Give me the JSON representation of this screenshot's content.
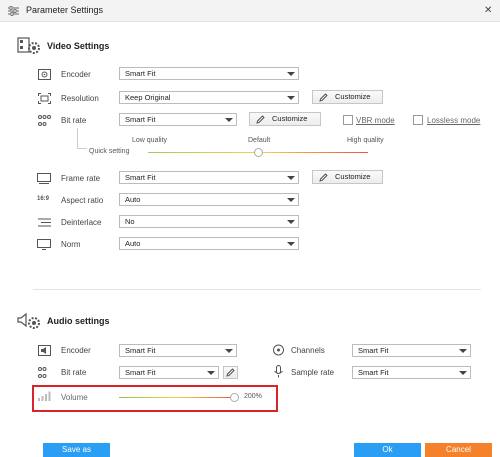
{
  "window": {
    "title": "Parameter Settings"
  },
  "video": {
    "section_title": "Video Settings",
    "encoder": {
      "label": "Encoder",
      "value": "Smart Fit"
    },
    "resolution": {
      "label": "Resolution",
      "value": "Keep Original",
      "customize": "Customize"
    },
    "bitrate": {
      "label": "Bit rate",
      "value": "Smart Fit",
      "customize": "Customize",
      "vbr_label": "VBR mode",
      "lossless_label": "Lossless mode",
      "quick_setting": "Quick setting",
      "low": "Low quality",
      "default": "Default",
      "high": "High quality",
      "quality_level": 0.5
    },
    "framerate": {
      "label": "Frame rate",
      "value": "Smart Fit",
      "customize": "Customize"
    },
    "aspect": {
      "label": "Aspect ratio",
      "value": "Auto"
    },
    "deinterlace": {
      "label": "Deinterlace",
      "value": "No"
    },
    "norm": {
      "label": "Norm",
      "value": "Auto"
    }
  },
  "audio": {
    "section_title": "Audio settings",
    "encoder": {
      "label": "Encoder",
      "value": "Smart Fit"
    },
    "channels": {
      "label": "Channels",
      "value": "Smart Fit"
    },
    "bitrate": {
      "label": "Bit rate",
      "value": "Smart Fit"
    },
    "samplerate": {
      "label": "Sample rate",
      "value": "Smart Fit"
    },
    "volume": {
      "label": "Volume",
      "value": "200%",
      "level": 1.0
    }
  },
  "buttons": {
    "save_as": "Save as",
    "ok": "Ok",
    "cancel": "Cancel"
  },
  "colors": {
    "primary": "#2a9df4",
    "cancel": "#f5812a",
    "highlight": "#d9252a"
  }
}
